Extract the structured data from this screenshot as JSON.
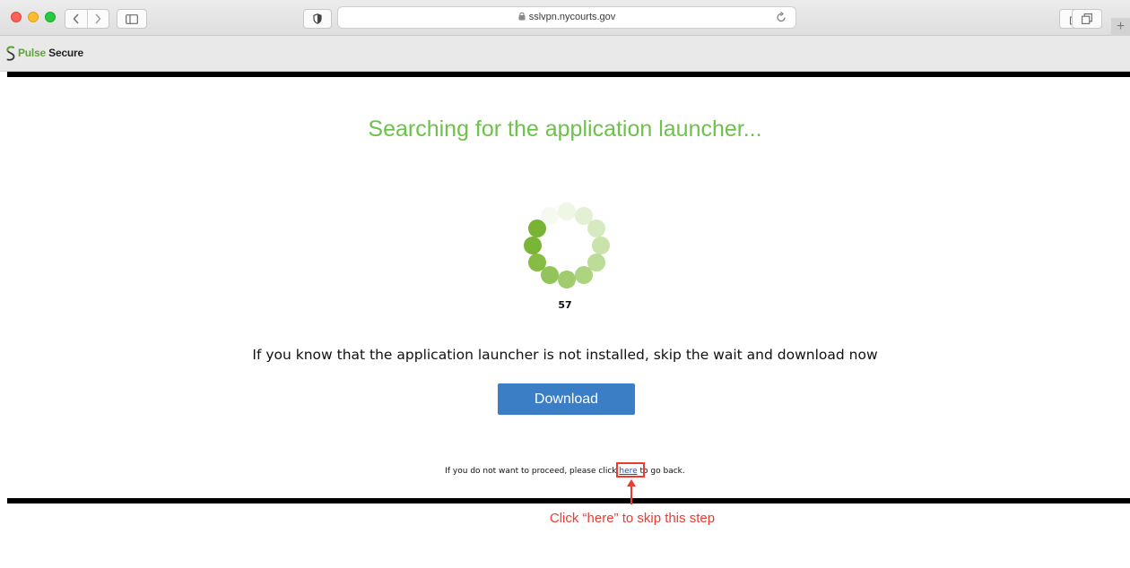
{
  "browser": {
    "url": "sslvpn.nycourts.gov",
    "new_tab_label": "+"
  },
  "header": {
    "logo_part1": "Pulse",
    "logo_part2": " Secure"
  },
  "main": {
    "heading": "Searching for the application launcher...",
    "countdown": "57",
    "instruction": "If you know that the application launcher is not installed, skip the wait and download now",
    "download_label": "Download",
    "footer_prefix": "If you do not want to proceed, please click ",
    "footer_link": "here",
    "footer_suffix": " to go back."
  },
  "annotation": {
    "text": "Click “here” to skip this step"
  },
  "colors": {
    "heading": "#6cc24a",
    "button": "#3b7ec6",
    "annotation": "#ec3b2f",
    "brand_green": "#5aa832"
  },
  "icons": [
    "back-icon",
    "forward-icon",
    "sidebar-icon",
    "shield-icon",
    "lock-icon",
    "reload-icon",
    "share-icon",
    "tabs-icon",
    "pulse-logo-icon",
    "spinner-icon",
    "arrow-up-icon"
  ]
}
